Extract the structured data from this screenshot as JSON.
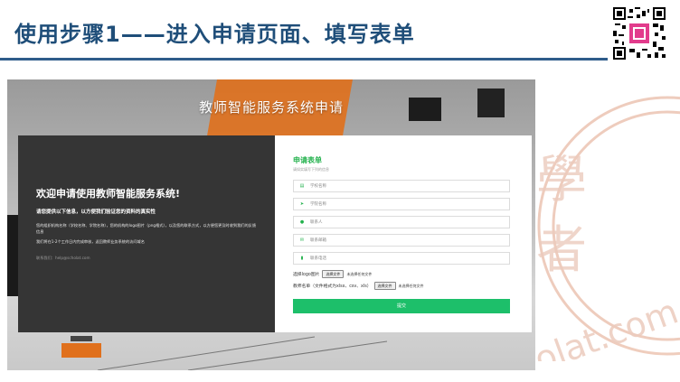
{
  "slide": {
    "title": "使用步骤1——进入申请页面、填写表单"
  },
  "app": {
    "system_title": "教师智能服务系统申请"
  },
  "welcome": {
    "title": "欢迎申请使用教师智能服务系统!",
    "subtitle": "请您提供以下信息，以方便我们验证您的资料的真实性",
    "description": "您的组织机构名称（学校名称、学院名称），您的机构的logo图片（png格式），以及您的联系方式，以方便您更及时收到我们的反馈信息",
    "description2": "我们将在1-2个工作日内完成审核，返回教师业务系统的访问域名",
    "contact": "联系我们：help@scholat.com"
  },
  "form": {
    "title": "申请表单",
    "subtitle": "请如实填写下列的信息",
    "fields": [
      {
        "icon": "building-icon",
        "placeholder": "学校名称"
      },
      {
        "icon": "send-icon",
        "placeholder": "学院名称"
      },
      {
        "icon": "person-icon",
        "placeholder": "联系人"
      },
      {
        "icon": "envelope-icon",
        "placeholder": "联系邮箱"
      },
      {
        "icon": "phone-icon",
        "placeholder": "联系电话"
      }
    ],
    "logo_label": "选择logo图片",
    "roster_label": "教师名单（文件格式为xlsx、csv、xls）",
    "file_button": "选择文件",
    "file_status": "未选择任何文件",
    "submit_label": "提交"
  },
  "colors": {
    "header_blue": "#1f4e79",
    "form_green": "#22b14c",
    "submit_green": "#1dbf6a",
    "panel_dark": "#353535",
    "watermark": "#e7b7a3"
  }
}
